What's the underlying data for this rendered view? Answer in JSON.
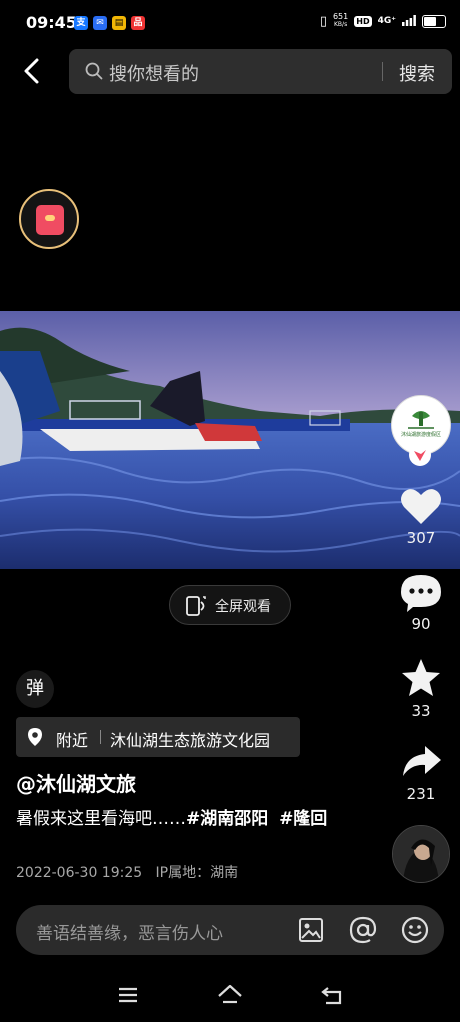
{
  "status_bar": {
    "time": "09:45",
    "net_speed_value": "651",
    "net_speed_unit": "KB/s",
    "hd": "HD",
    "network": "4G⁺"
  },
  "search": {
    "placeholder": "搜你想看的",
    "button_label": "搜索"
  },
  "video": {
    "brand_logo_text": "沐仙湖旅游度假区"
  },
  "actions": {
    "like_count": "307",
    "comment_count": "90",
    "favorite_count": "33",
    "share_count": "231"
  },
  "fullscreen_label": "全屏观看",
  "danmu_label": "弹",
  "location": {
    "near_label": "附近",
    "place": "沐仙湖生态旅游文化园"
  },
  "post": {
    "author": "@沐仙湖文旅",
    "text": "暑假来这里看海吧……",
    "tag1": "#湖南邵阳",
    "tag2": "#隆回",
    "date": "2022-06-30 19:25",
    "ip_location": "IP属地：湖南"
  },
  "comment": {
    "placeholder": "善语结善缘，恶言伤人心"
  },
  "colors": {
    "accent_red": "#f04c62",
    "redpacket_ring": "#e8c07a",
    "background": "#000000"
  },
  "icons": [
    "back-icon",
    "search-icon",
    "red-packet-icon",
    "heart-icon",
    "comment-icon",
    "star-icon",
    "share-icon",
    "fullscreen-icon",
    "location-pin-icon",
    "image-icon",
    "at-icon",
    "emoji-icon",
    "menu-icon",
    "home-icon",
    "back-nav-icon"
  ]
}
